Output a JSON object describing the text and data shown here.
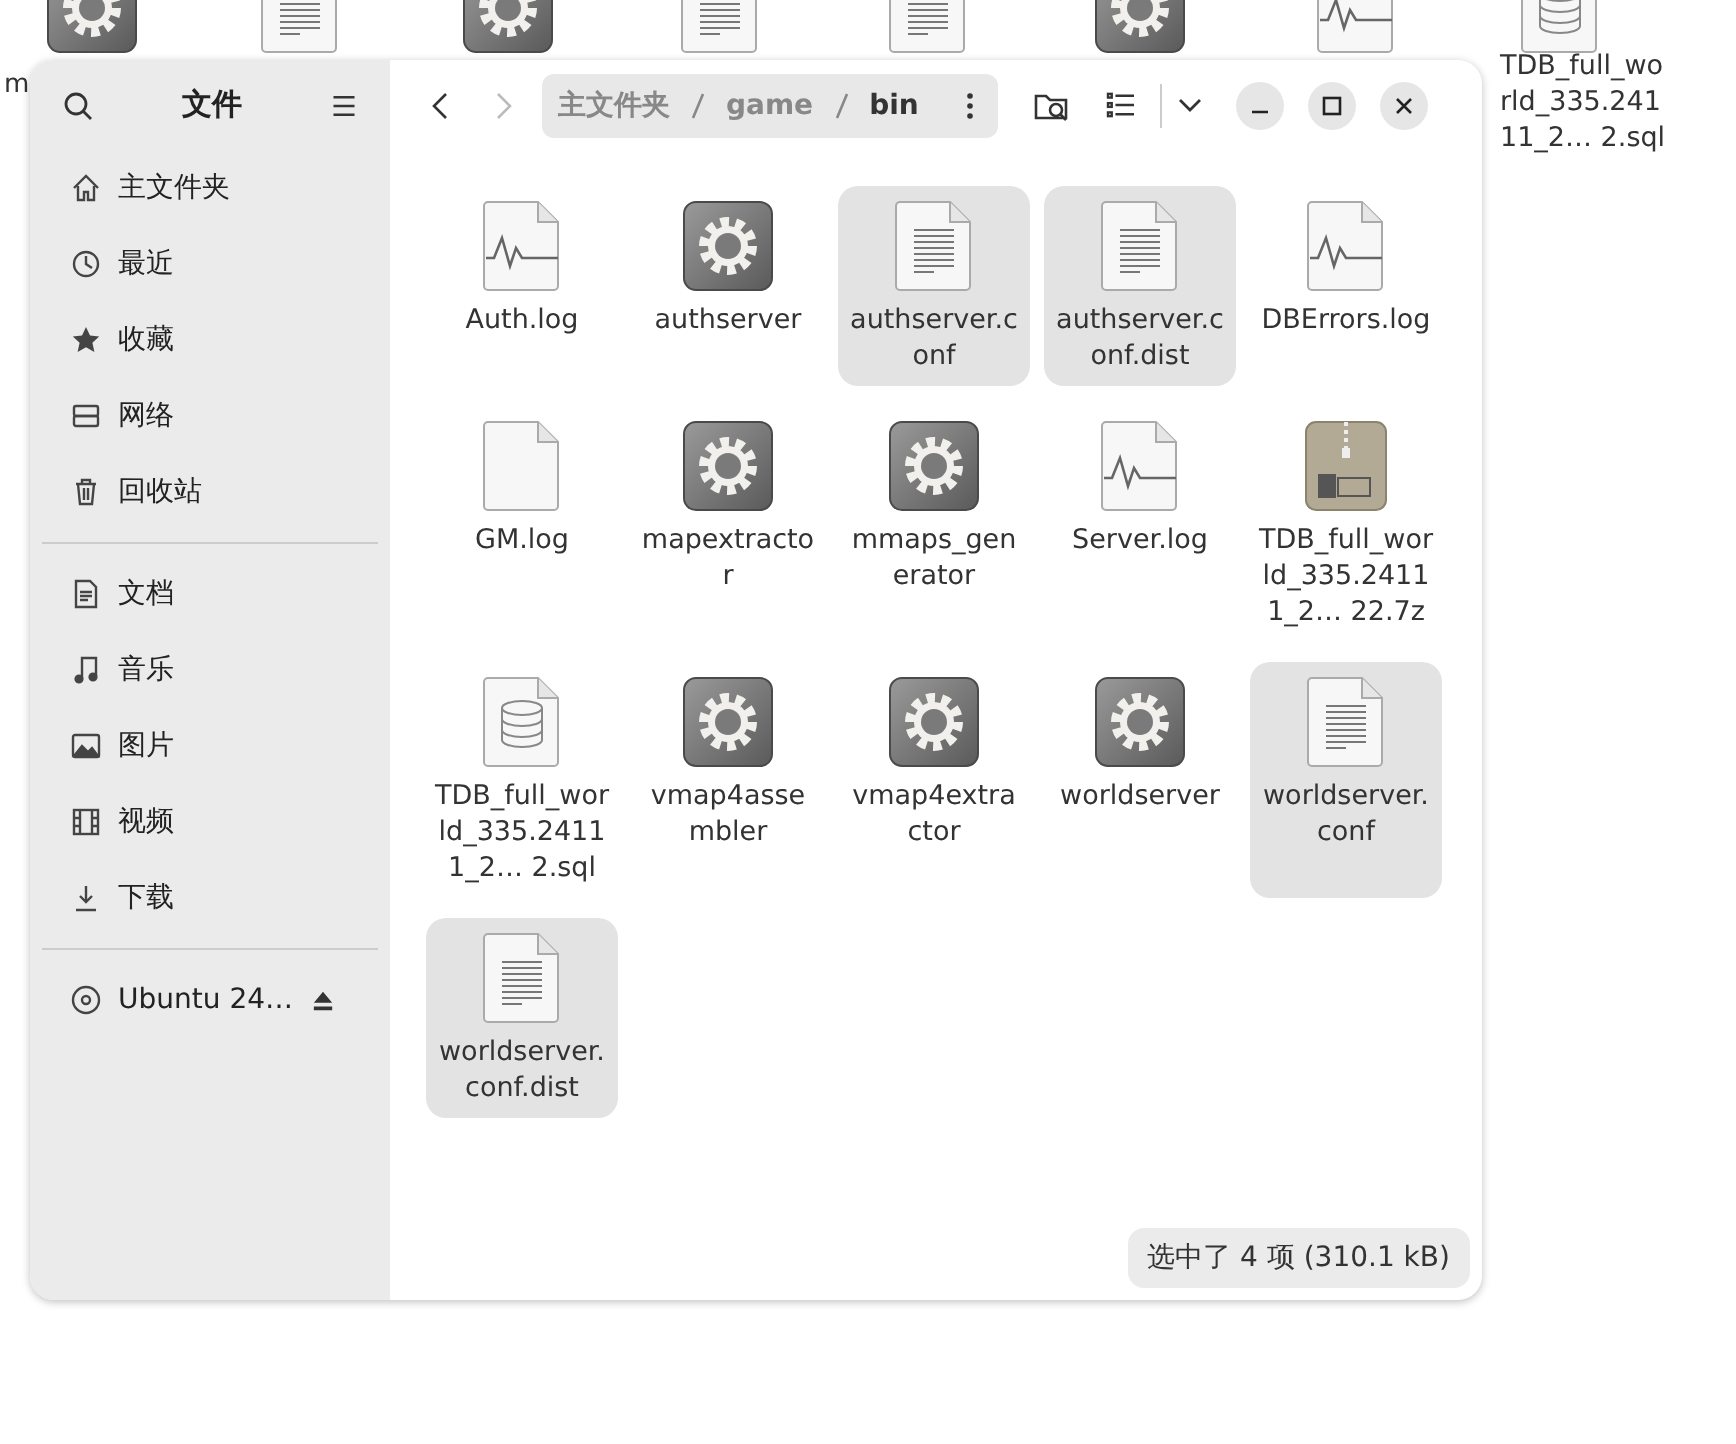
{
  "desktop": {
    "items": [
      {
        "kind": "executable",
        "label": "m"
      },
      {
        "kind": "text"
      },
      {
        "kind": "executable"
      },
      {
        "kind": "text"
      },
      {
        "kind": "text"
      },
      {
        "kind": "executable"
      },
      {
        "kind": "log"
      },
      {
        "kind": "database",
        "label": "TDB_full_wo rld_335.241 11_2…  2.sql"
      }
    ]
  },
  "window": {
    "title": "文件",
    "nav": {
      "back_disabled": false,
      "forward_disabled": true
    },
    "path": [
      {
        "label": "主文件夹",
        "selected": false
      },
      {
        "label": "game",
        "selected": false
      },
      {
        "label": "bin",
        "selected": true
      }
    ]
  },
  "sidebar": {
    "sections": [
      [
        {
          "kind": "home",
          "label": "主文件夹"
        },
        {
          "kind": "recent",
          "label": "最近"
        },
        {
          "kind": "star",
          "label": "收藏"
        },
        {
          "kind": "network",
          "label": "网络"
        },
        {
          "kind": "trash",
          "label": "回收站"
        }
      ],
      [
        {
          "kind": "document",
          "label": "文档"
        },
        {
          "kind": "music",
          "label": "音乐"
        },
        {
          "kind": "picture",
          "label": "图片"
        },
        {
          "kind": "video",
          "label": "视频"
        },
        {
          "kind": "download",
          "label": "下载"
        }
      ],
      [
        {
          "kind": "disc",
          "label": "Ubuntu 24…",
          "ejectable": true
        }
      ]
    ]
  },
  "files": [
    {
      "kind": "log",
      "name": "Auth.log",
      "selected": false
    },
    {
      "kind": "executable",
      "name": "authserver",
      "selected": false
    },
    {
      "kind": "text",
      "name": "authserver.conf",
      "selected": true
    },
    {
      "kind": "text",
      "name": "authserver.conf.dist",
      "selected": true
    },
    {
      "kind": "log",
      "name": "DBErrors.log",
      "selected": false
    },
    {
      "kind": "blank",
      "name": "GM.log",
      "selected": false
    },
    {
      "kind": "executable",
      "name": "mapextractor",
      "selected": false
    },
    {
      "kind": "executable",
      "name": "mmaps_generator",
      "selected": false
    },
    {
      "kind": "log",
      "name": "Server.log",
      "selected": false
    },
    {
      "kind": "zip",
      "name": "TDB_full_world_335.24111_2…  22.7z",
      "selected": false
    },
    {
      "kind": "database",
      "name": "TDB_full_world_335.24111_2…  2.sql",
      "selected": false
    },
    {
      "kind": "executable",
      "name": "vmap4assembler",
      "selected": false
    },
    {
      "kind": "executable",
      "name": "vmap4extractor",
      "selected": false
    },
    {
      "kind": "executable",
      "name": "worldserver",
      "selected": false
    },
    {
      "kind": "text",
      "name": "worldserver.conf",
      "selected": true
    },
    {
      "kind": "text",
      "name": "worldserver.conf.dist",
      "selected": true
    }
  ],
  "status_bar": "选中了 4 项 (310.1 kB)"
}
